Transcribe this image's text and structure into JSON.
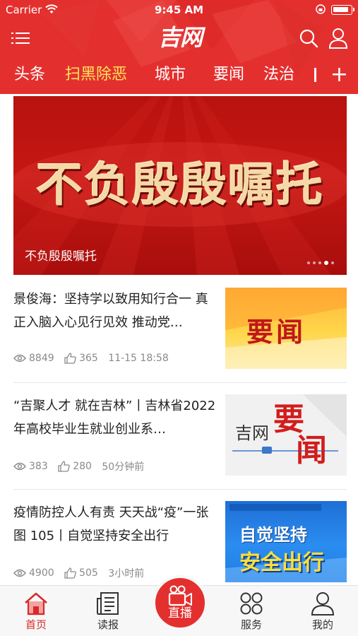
{
  "status_bar": {
    "carrier": "Carrier",
    "time": "9:45 AM"
  },
  "header": {
    "logo_text": "吉网",
    "menu_icon": "menu-icon",
    "search_icon": "search-icon",
    "user_icon": "user-icon"
  },
  "tabs": [
    {
      "label": "头条",
      "active": false
    },
    {
      "label": "扫黑除恶",
      "active": true
    },
    {
      "label": "城市",
      "active": false
    },
    {
      "label": "要闻",
      "active": false
    },
    {
      "label": "法治",
      "active": false
    }
  ],
  "tab_add_label": "+",
  "banner": {
    "art_text": "不负殷殷嘱托",
    "caption": "不负殷殷嘱托",
    "dots": 5,
    "active_dot": 4
  },
  "news": [
    {
      "title": "景俊海：坚持学以致用知行合一 真正入脑入心见行见效 推动党…",
      "views": "8849",
      "likes": "365",
      "time": "11-15 18:58",
      "thumb": {
        "text": "要闻"
      }
    },
    {
      "title": "“吉聚人才 就在吉林”丨吉林省2022年高校毕业生就业创业系…",
      "views": "383",
      "likes": "280",
      "time": "50分钟前",
      "thumb": {
        "text_a": "吉网",
        "text_b": "要",
        "text_c": "闻"
      }
    },
    {
      "title": "疫情防控人人有责 天天战“疫”一张图 105丨自觉坚持安全出行",
      "views": "4900",
      "likes": "505",
      "time": "3小时前",
      "thumb": {
        "line1": "自觉坚持",
        "line2": "安全出行"
      }
    }
  ],
  "bottom_nav": [
    {
      "label": "首页",
      "icon": "home-icon",
      "active": true
    },
    {
      "label": "读报",
      "icon": "newspaper-icon",
      "active": false
    },
    {
      "label": "直播",
      "icon": "video-camera-icon",
      "active": false
    },
    {
      "label": "服务",
      "icon": "services-icon",
      "active": false
    },
    {
      "label": "我的",
      "icon": "profile-icon",
      "active": false
    }
  ],
  "colors": {
    "brand_red": "#e3302f",
    "active_tab": "#ffe45a",
    "meta_gray": "#8a8a8a"
  }
}
